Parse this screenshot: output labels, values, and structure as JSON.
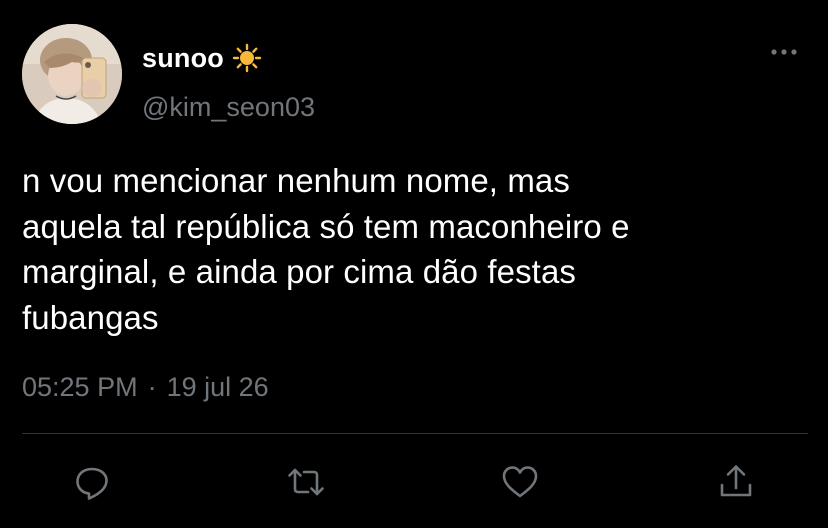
{
  "author": {
    "display_name": "sunoo",
    "name_emoji": "sun-emoji-icon",
    "handle": "@kim_seon03"
  },
  "tweet": {
    "text": "n vou mencionar nenhum nome, mas\naquela tal república só tem maconheiro e\nmarginal, e ainda por cima dão festas\nfubangas",
    "time": "05:25 PM",
    "separator": "·",
    "date": "19 jul 26"
  },
  "actions": {
    "reply": "reply-icon",
    "retweet": "retweet-icon",
    "like": "like-icon",
    "share": "share-icon"
  },
  "colors": {
    "background": "#000000",
    "primary_text": "#ffffff",
    "secondary_text": "#71767b",
    "divider": "#2f3336",
    "sun": "#f6b93b"
  }
}
